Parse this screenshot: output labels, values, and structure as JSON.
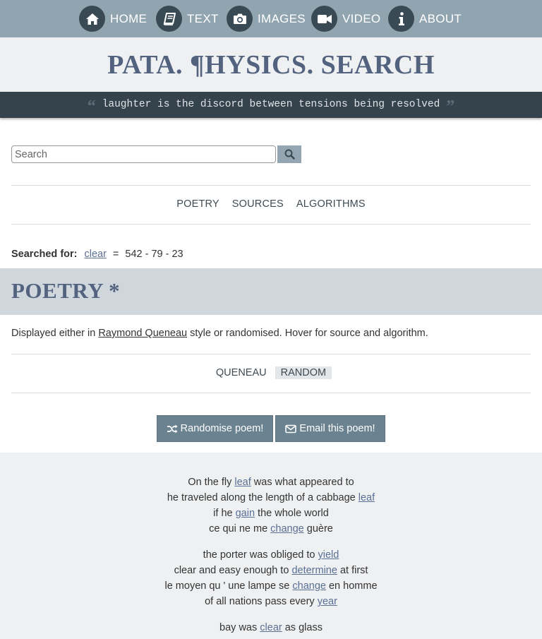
{
  "nav": {
    "items": [
      {
        "label": "HOME",
        "icon": "home-icon"
      },
      {
        "label": "TEXT",
        "icon": "book-icon"
      },
      {
        "label": "IMAGES",
        "icon": "camera-icon"
      },
      {
        "label": "VIDEO",
        "icon": "video-icon"
      },
      {
        "label": "ABOUT",
        "icon": "info-icon"
      }
    ]
  },
  "header": {
    "title": "PATA. ¶HYSICS. SEARCH",
    "quote": "laughter is the discord between tensions being resolved"
  },
  "search": {
    "placeholder": "Search",
    "value": ""
  },
  "section_tabs": [
    "POETRY",
    "SOURCES",
    "ALGORITHMS"
  ],
  "searched_for": {
    "label": "Searched for:",
    "term": "clear",
    "equals": "=",
    "counts": "542 - 79 - 23"
  },
  "poetry": {
    "title": "POETRY *",
    "description_before": "Displayed either in ",
    "description_link": "Raymond Queneau",
    "description_after": " style or randomised. Hover for source and algorithm.",
    "toggles": [
      "QUENEAU",
      "RANDOM"
    ],
    "active_toggle": "RANDOM",
    "randomise_label": "Randomise poem!",
    "email_label": "Email this poem!"
  },
  "poem": {
    "stanzas": [
      [
        {
          "before": "On the fly ",
          "word": "leaf",
          "after": " was what appeared to"
        },
        {
          "before": "he traveled along the length of a cabbage ",
          "word": "leaf",
          "after": ""
        },
        {
          "before": "if he ",
          "word": "gain",
          "after": " the whole world"
        },
        {
          "before": "ce qui ne me ",
          "word": "change",
          "after": " guère"
        }
      ],
      [
        {
          "before": "the porter was obliged to ",
          "word": "yield",
          "after": ""
        },
        {
          "before": "clear and easy enough to ",
          "word": "determine",
          "after": " at first"
        },
        {
          "before": "le moyen qu ' une lampe se ",
          "word": "change",
          "after": " en homme"
        },
        {
          "before": "of all nations pass every ",
          "word": "year",
          "after": ""
        }
      ],
      [
        {
          "before": "bay was ",
          "word": "clear",
          "after": " as glass"
        }
      ]
    ]
  },
  "colors": {
    "nav_bg": "#91a5b1",
    "title_color": "#52627f",
    "quote_bg": "#35434d",
    "button_bg": "#6b8290",
    "link_color": "#5a6f94"
  }
}
